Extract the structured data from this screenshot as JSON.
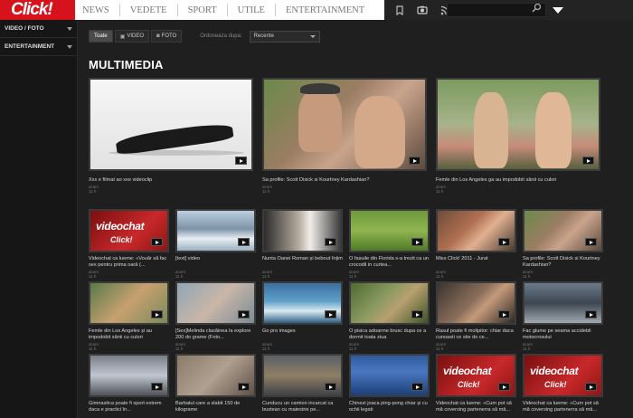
{
  "header": {
    "logo": "Click!",
    "nav": [
      "NEWS",
      "VEDETE",
      "SPORT",
      "UTILE",
      "ENTERTAINMENT"
    ],
    "icons": [
      "bookmark-icon",
      "camera-icon",
      "rss-icon"
    ],
    "search_placeholder": ""
  },
  "sidebar": {
    "items": [
      {
        "label": "VIDEO / FOTO"
      },
      {
        "label": "ENTERTAINMENT"
      }
    ]
  },
  "filters": {
    "all": "Toate",
    "video": "VIDEO",
    "foto": "FOTO",
    "sort_label": "Ordoneaza dupa:",
    "sort_value": "Recente"
  },
  "section": {
    "title": "MULTIMEDIA"
  },
  "featured": [
    {
      "caption": "Xxx e filmat ao xxe videoclip",
      "date": "acum 11 h"
    },
    {
      "caption": "Sa profile: Scott Disick si Kourtney Kardashian?",
      "date": "acum 11 h"
    },
    {
      "caption": "Femle din Los Angeles ga au impodobit sânii cu culori",
      "date": "acum 11 h"
    }
  ],
  "grid": [
    {
      "caption": "Videochat ca lueme: «Vouăr să fac sex pentru prima oară (...",
      "date": "acum 11 h"
    },
    {
      "caption": "[text] video",
      "date": "acum 11 h"
    },
    {
      "caption": "Nunta Oanei Roman și bebout înțim",
      "date": "acum 11 h"
    },
    {
      "caption": "O fasuile din Florida s-a trezit ca un crocodil in curtea...",
      "date": "acum 11 h"
    },
    {
      "caption": "Miss Click! 2011 - Jurat",
      "date": "acum 11 h"
    },
    {
      "caption": "Sa profile: Scott Disick si Kourtney Kardashian?",
      "date": "acum 11 h"
    },
    {
      "caption": "Femle din Los Angeles și au impodobit sânii cu culori",
      "date": "acum 11 h"
    },
    {
      "caption": "[Sex]Melinda clasăinea la explore 200 do grame (Foto...",
      "date": "acum 11 h"
    },
    {
      "caption": "Go pro images",
      "date": "acum 11 h"
    },
    {
      "caption": "O pisica adoarme brusc dupa ce a dormit toata ziua",
      "date": "acum 11 h"
    },
    {
      "caption": "Rasul poate fi molipitor: chiar daca cunoasti ce stie do ce...",
      "date": "acum 11 h"
    },
    {
      "caption": "Fac glume pe seama accidebil motocrosului",
      "date": "acum 11 h"
    },
    {
      "caption": "Gimnastica poate fi sport extrem daca e practici în...",
      "date": "acum 11 h"
    },
    {
      "caption": "Barbatul care a slabit 150 de kilograme",
      "date": "acum 11 h"
    },
    {
      "caption": "Cunducu un camion incarcat ca bustean cu maiestrie pe...",
      "date": "acum 11 h"
    },
    {
      "caption": "Chinezi joaca ping-pong chiar și cu ochii legati",
      "date": "acum 11 h"
    },
    {
      "caption": "Videochat ca lueme: «Cum pot să mă coversing partenerra să mă...",
      "date": "acum 11 h"
    },
    {
      "caption": "Videochat ca lueme: «Cum pot să mă coversing partenerra să mă...",
      "date": "acum 11 h"
    }
  ],
  "chat_badge": {
    "word": "videochat",
    "brand": "Click!"
  },
  "colors": {
    "brand_red": "#d6121b",
    "bg": "#1f1f1f"
  }
}
